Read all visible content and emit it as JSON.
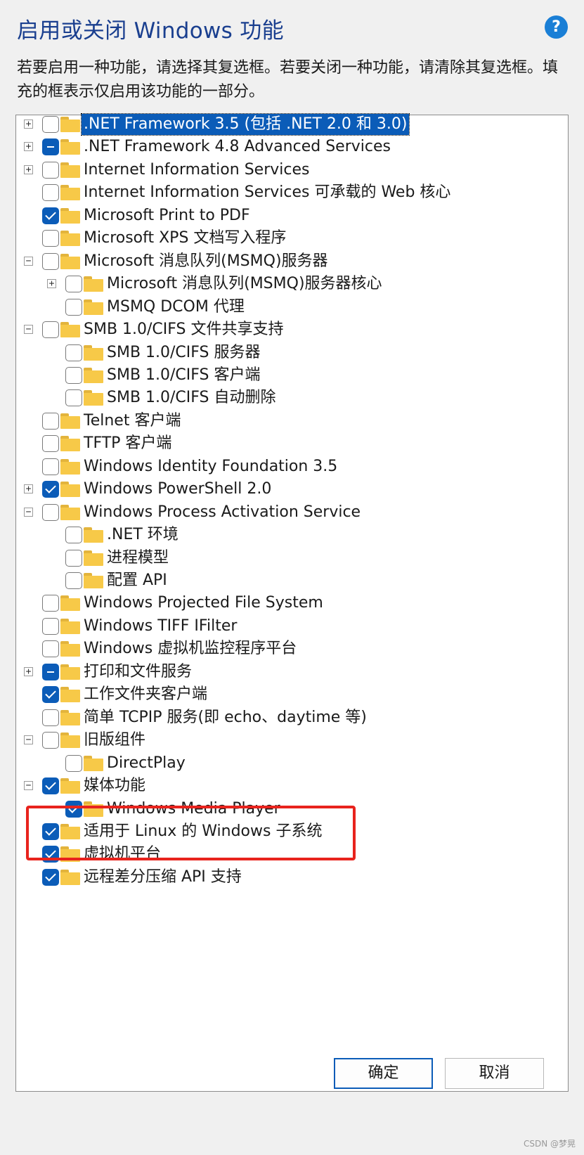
{
  "window": {
    "title": "启用或关闭 Windows 功能",
    "help_label": "?",
    "description": "若要启用一种功能，请选择其复选框。若要关闭一种功能，请清除其复选框。填充的框表示仅启用该功能的一部分。"
  },
  "features": [
    {
      "label": ".NET Framework 3.5 (包括 .NET 2.0 和 3.0)",
      "level": 0,
      "expander": "+",
      "state": "unchecked",
      "selected": true
    },
    {
      "label": ".NET Framework 4.8 Advanced Services",
      "level": 0,
      "expander": "+",
      "state": "partial"
    },
    {
      "label": "Internet Information Services",
      "level": 0,
      "expander": "+",
      "state": "unchecked"
    },
    {
      "label": "Internet Information Services 可承载的 Web 核心",
      "level": 0,
      "expander": "",
      "state": "unchecked"
    },
    {
      "label": "Microsoft Print to PDF",
      "level": 0,
      "expander": "",
      "state": "checked"
    },
    {
      "label": "Microsoft XPS 文档写入程序",
      "level": 0,
      "expander": "",
      "state": "unchecked"
    },
    {
      "label": "Microsoft 消息队列(MSMQ)服务器",
      "level": 0,
      "expander": "−",
      "state": "unchecked"
    },
    {
      "label": "Microsoft 消息队列(MSMQ)服务器核心",
      "level": 1,
      "expander": "+",
      "state": "unchecked"
    },
    {
      "label": "MSMQ DCOM 代理",
      "level": 1,
      "expander": "",
      "state": "unchecked"
    },
    {
      "label": "SMB 1.0/CIFS 文件共享支持",
      "level": 0,
      "expander": "−",
      "state": "unchecked"
    },
    {
      "label": "SMB 1.0/CIFS 服务器",
      "level": 1,
      "expander": "",
      "state": "unchecked"
    },
    {
      "label": "SMB 1.0/CIFS 客户端",
      "level": 1,
      "expander": "",
      "state": "unchecked"
    },
    {
      "label": "SMB 1.0/CIFS 自动删除",
      "level": 1,
      "expander": "",
      "state": "unchecked"
    },
    {
      "label": "Telnet 客户端",
      "level": 0,
      "expander": "",
      "state": "unchecked"
    },
    {
      "label": "TFTP 客户端",
      "level": 0,
      "expander": "",
      "state": "unchecked"
    },
    {
      "label": "Windows Identity Foundation 3.5",
      "level": 0,
      "expander": "",
      "state": "unchecked"
    },
    {
      "label": "Windows PowerShell 2.0",
      "level": 0,
      "expander": "+",
      "state": "checked"
    },
    {
      "label": "Windows Process Activation Service",
      "level": 0,
      "expander": "−",
      "state": "unchecked"
    },
    {
      "label": ".NET 环境",
      "level": 1,
      "expander": "",
      "state": "unchecked"
    },
    {
      "label": "进程模型",
      "level": 1,
      "expander": "",
      "state": "unchecked"
    },
    {
      "label": "配置 API",
      "level": 1,
      "expander": "",
      "state": "unchecked"
    },
    {
      "label": "Windows Projected File System",
      "level": 0,
      "expander": "",
      "state": "unchecked"
    },
    {
      "label": "Windows TIFF IFilter",
      "level": 0,
      "expander": "",
      "state": "unchecked"
    },
    {
      "label": "Windows 虚拟机监控程序平台",
      "level": 0,
      "expander": "",
      "state": "unchecked"
    },
    {
      "label": "打印和文件服务",
      "level": 0,
      "expander": "+",
      "state": "partial"
    },
    {
      "label": "工作文件夹客户端",
      "level": 0,
      "expander": "",
      "state": "checked"
    },
    {
      "label": "简单 TCPIP 服务(即 echo、daytime 等)",
      "level": 0,
      "expander": "",
      "state": "unchecked"
    },
    {
      "label": "旧版组件",
      "level": 0,
      "expander": "−",
      "state": "unchecked"
    },
    {
      "label": "DirectPlay",
      "level": 1,
      "expander": "",
      "state": "unchecked"
    },
    {
      "label": "媒体功能",
      "level": 0,
      "expander": "−",
      "state": "checked"
    },
    {
      "label": "Windows Media Player",
      "level": 1,
      "expander": "",
      "state": "checked"
    },
    {
      "label": "适用于 Linux 的 Windows 子系统",
      "level": 0,
      "expander": "",
      "state": "checked"
    },
    {
      "label": "虚拟机平台",
      "level": 0,
      "expander": "",
      "state": "checked"
    },
    {
      "label": "远程差分压缩 API 支持",
      "level": 0,
      "expander": "",
      "state": "checked"
    }
  ],
  "buttons": {
    "ok_label": "确定",
    "cancel_label": "取消"
  },
  "watermark": "CSDN @梦晃",
  "colors": {
    "accent": "#0b5cb8",
    "title": "#1a3f8f",
    "highlight_box": "#e8231d",
    "folder": "#f7c948"
  }
}
